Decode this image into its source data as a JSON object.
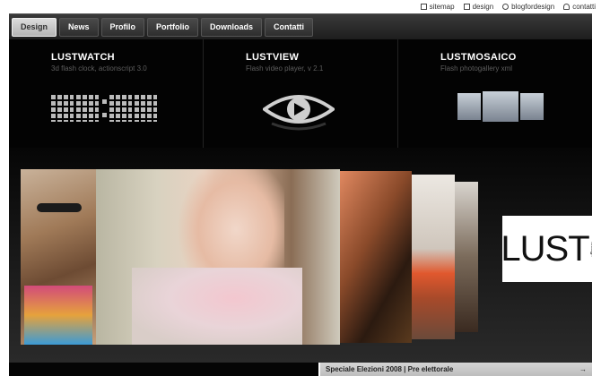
{
  "top_links": [
    {
      "label": "sitemap",
      "icon": "sitemap-icon"
    },
    {
      "label": "design",
      "icon": "mail-icon"
    },
    {
      "label": "blogfordesign",
      "icon": "rss-icon"
    },
    {
      "label": "contatti",
      "icon": "user-icon"
    }
  ],
  "nav": {
    "tabs": [
      {
        "label": "Design",
        "active": true
      },
      {
        "label": "News"
      },
      {
        "label": "Profilo"
      },
      {
        "label": "Portfolio"
      },
      {
        "label": "Downloads"
      },
      {
        "label": "Contatti"
      }
    ]
  },
  "products": [
    {
      "title": "LUSTWATCH",
      "subtitle": "3d flash clock, actionscript 3.0",
      "visual": "digital-clock-icon"
    },
    {
      "title": "LUSTVIEW",
      "subtitle": "Flash video player, v 2.1",
      "visual": "eye-play-icon"
    },
    {
      "title": "LUSTMOSAICO",
      "subtitle": "Flash photogallery xml",
      "visual": "gallery-panels-icon"
    }
  ],
  "gallery": {
    "logo_text": "LUST",
    "logo_sub": "fordesign"
  },
  "news": {
    "headline": "Speciale Elezioni 2008 | Pre elettorale",
    "arrow": "→"
  },
  "colors": {
    "accent": "#cfcfcf",
    "dark": "#030303"
  }
}
